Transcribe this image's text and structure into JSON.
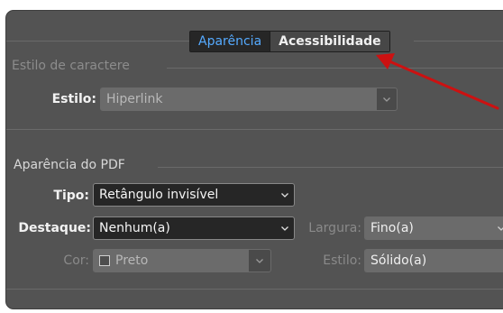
{
  "tabs": [
    {
      "label": "Aparência",
      "active": true
    },
    {
      "label": "Acessibilidade",
      "active": false
    }
  ],
  "character_style": {
    "section_title": "Estilo de caractere",
    "style_label": "Estilo:",
    "style_value": "Hiperlink"
  },
  "pdf_appearance": {
    "section_title": "Aparência do PDF",
    "type_label": "Tipo:",
    "type_value": "Retângulo invisível",
    "highlight_label": "Destaque:",
    "highlight_value": "Nenhum(a)",
    "width_label": "Largura:",
    "width_value": "Fino(a)",
    "color_label": "Cor:",
    "color_value": "Preto",
    "style_label": "Estilo:",
    "style_value": "Sólido(a)"
  },
  "colors": {
    "panel_bg": "#535353",
    "accent": "#55aaff",
    "annotation_arrow": "#cc1111"
  },
  "icons": [
    "chevron-down-icon",
    "color-swatch-icon",
    "red-annotation-arrow-icon"
  ]
}
